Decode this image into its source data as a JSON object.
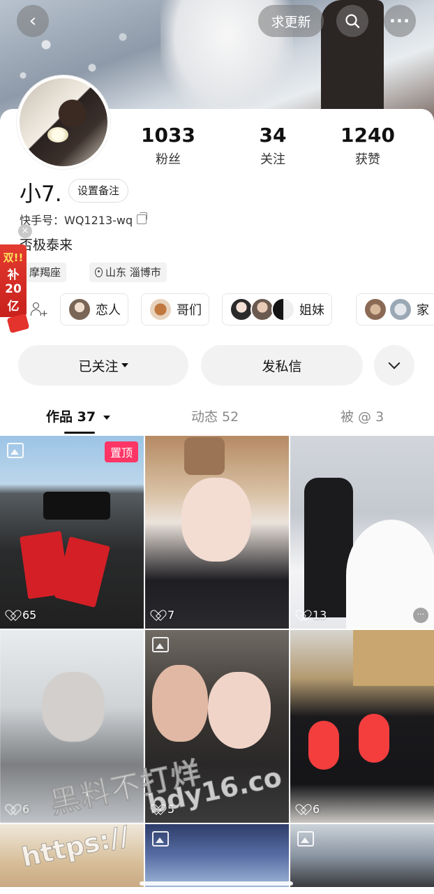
{
  "header": {
    "back_icon": "chevron-left-icon",
    "update_label": "求更新",
    "search_icon": "search-icon",
    "more_icon": "more-icon"
  },
  "profile": {
    "stats": [
      {
        "num": "1033",
        "label": "粉丝"
      },
      {
        "num": "34",
        "label": "关注"
      },
      {
        "num": "1240",
        "label": "获赞"
      }
    ],
    "name": "小7.",
    "remark_label": "设置备注",
    "kuaishou_id": "快手号：WQ1213-wq",
    "bio": "否极泰来",
    "tags": [
      "摩羯座",
      "山东 淄博市"
    ]
  },
  "promo": {
    "line1": "双!!",
    "line2": "补",
    "line3": "20",
    "line4": "亿"
  },
  "relations": [
    {
      "label": "恋人"
    },
    {
      "label": "哥们"
    },
    {
      "label": "姐妹"
    },
    {
      "label": "家"
    }
  ],
  "actions": {
    "follow_label": "已关注",
    "message_label": "发私信"
  },
  "tabs": [
    {
      "label": "作品 37"
    },
    {
      "label": "动态 52"
    },
    {
      "label": "被 @ 3"
    }
  ],
  "posts": [
    {
      "likes": "65",
      "badge": "置顶"
    },
    {
      "likes": "7"
    },
    {
      "likes": "13"
    },
    {
      "likes": "6"
    },
    {
      "likes": "5"
    },
    {
      "likes": "6"
    }
  ],
  "watermark": {
    "line1": "黑料不打烊",
    "line2": "bdy16.co",
    "line3": "https://"
  }
}
